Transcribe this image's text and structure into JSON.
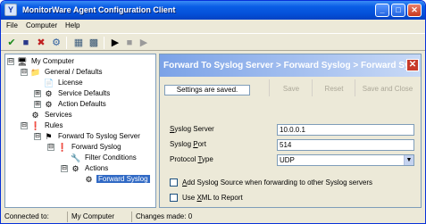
{
  "window": {
    "title": "MonitorWare Agent Configuration Client",
    "app_icon": "Y",
    "minimize_glyph": "_",
    "maximize_glyph": "□",
    "close_glyph": "✕"
  },
  "menu": [
    "File",
    "Computer",
    "Help"
  ],
  "toolbar": [
    {
      "name": "ok-icon",
      "glyph": "✔",
      "color": "#1a8a1a"
    },
    {
      "name": "save-icon",
      "glyph": "■",
      "color": "#2a3a8a"
    },
    {
      "name": "cancel-icon",
      "glyph": "✖",
      "color": "#c02020"
    },
    {
      "name": "network-icon",
      "glyph": "⚙",
      "color": "#3060a0"
    },
    {
      "name": "screen-icon",
      "glyph": "▦",
      "color": "#406080"
    },
    {
      "name": "grid-icon",
      "glyph": "▩",
      "color": "#305070"
    },
    {
      "name": "play-icon",
      "glyph": "▶",
      "color": "#000000"
    },
    {
      "name": "stop-icon",
      "glyph": "■",
      "color": "#9a9a9a"
    },
    {
      "name": "restart-icon",
      "glyph": "▶",
      "color": "#9a9a9a"
    }
  ],
  "tree": [
    {
      "label": "My Computer",
      "expander": "⊟",
      "icon": "computer-icon",
      "glyph": "🖥",
      "selected": false
    },
    {
      "label": "General / Defaults",
      "expander": "⊟",
      "icon": "folder-icon",
      "glyph": "📁",
      "selected": false
    },
    {
      "label": "License",
      "expander": "",
      "icon": "license-icon",
      "glyph": "📄",
      "selected": false
    },
    {
      "label": "Service Defaults",
      "expander": "⊞",
      "icon": "service-defaults-icon",
      "glyph": "⚙",
      "selected": false
    },
    {
      "label": "Action Defaults",
      "expander": "⊞",
      "icon": "action-defaults-icon",
      "glyph": "⚙",
      "selected": false
    },
    {
      "label": "Services",
      "expander": "",
      "icon": "services-icon",
      "glyph": "⚙",
      "selected": false
    },
    {
      "label": "Rules",
      "expander": "⊟",
      "icon": "rules-icon",
      "glyph": "❗",
      "selected": false
    },
    {
      "label": "Forward To Syslog Server",
      "expander": "⊟",
      "icon": "ruleset-icon",
      "glyph": "⚑",
      "selected": false
    },
    {
      "label": "Forward Syslog",
      "expander": "⊟",
      "icon": "rule-icon",
      "glyph": "❗",
      "selected": false
    },
    {
      "label": "Filter Conditions",
      "expander": "",
      "icon": "filter-icon",
      "glyph": "🔧",
      "selected": false
    },
    {
      "label": "Actions",
      "expander": "⊟",
      "icon": "actions-icon",
      "glyph": "⚙",
      "selected": false
    },
    {
      "label": "Forward Syslog",
      "expander": "",
      "icon": "forward-syslog-icon",
      "glyph": "⚙",
      "selected": true
    }
  ],
  "panel": {
    "header": "Forward To Syslog Server > Forward Syslog > Forward Syslog",
    "close_glyph": "✕",
    "status_message": "Settings are saved.",
    "buttons": [
      "Save",
      "Reset",
      "Save and Close"
    ],
    "fields": [
      {
        "label_u": "S",
        "label_rest": "yslog Server",
        "value": "10.0.0.1"
      },
      {
        "label_pre": "Syslog ",
        "label_u": "P",
        "label_rest": "ort",
        "value": "514"
      },
      {
        "label_pre": "Protocol ",
        "label_u": "T",
        "label_rest": "ype",
        "value": "UDP",
        "arrow": "▼"
      }
    ],
    "checkboxes": [
      {
        "label_u": "A",
        "label_rest": "dd Syslog Source when forwarding to other Syslog servers",
        "checked": false
      },
      {
        "label_pre": "Use ",
        "label_u": "X",
        "label_rest": "ML to Report",
        "checked": false
      }
    ]
  },
  "statusbar": {
    "connected_label": "Connected to:",
    "computer": "My Computer",
    "changes": "Changes made: 0"
  }
}
